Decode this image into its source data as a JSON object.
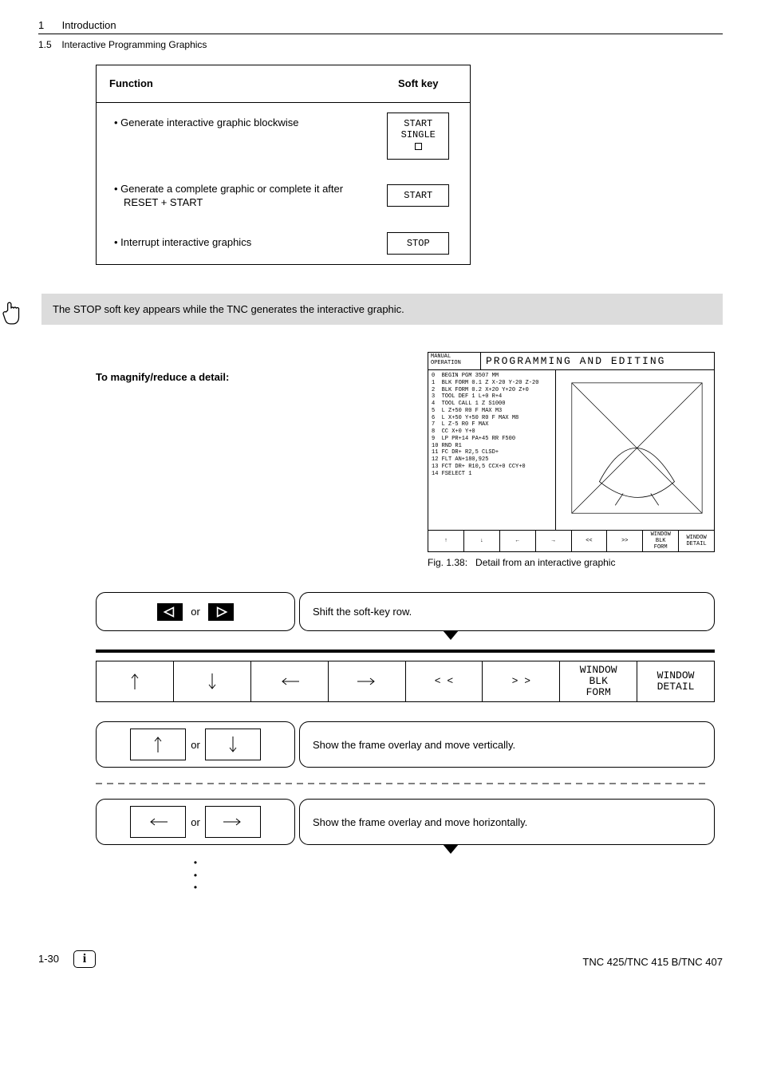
{
  "header": {
    "chapter_num": "1",
    "chapter_title": "Introduction",
    "section_num": "1.5",
    "section_title": "Interactive Programming Graphics"
  },
  "fn_table": {
    "head_l": "Function",
    "head_r": "Soft key",
    "rows": [
      {
        "text": "Generate interactive graphic blockwise",
        "key_l1": "START",
        "key_l2": "SINGLE",
        "has_square": true
      },
      {
        "text": "Generate a complete graphic or complete it after RESET + START",
        "key_l1": "START",
        "key_l2": "",
        "has_square": false
      },
      {
        "text": "Interrupt interactive graphics",
        "key_l1": "STOP",
        "key_l2": "",
        "has_square": false
      }
    ]
  },
  "note": "The STOP soft key appears while the TNC generates the interactive graphic.",
  "subhead": "To magnify/reduce a detail:",
  "screen": {
    "mode_l1": "MANUAL",
    "mode_l2": "OPERATION",
    "title": "PROGRAMMING AND EDITING",
    "code": "0  BEGIN PGM 3507 MM\n1  BLK FORM 0.1 Z X-20 Y-20 Z-20\n2  BLK FORM 0.2 X+20 Y+20 Z+0\n3  TOOL DEF 1 L+0 R+4\n4  TOOL CALL 1 Z S1000\n5  L Z+50 R0 F MAX M3\n6  L X+50 Y+50 R0 F MAX M8\n7  L Z-5 R0 F MAX\n8  CC X+0 Y+0\n9  LP PR+14 PA+45 RR F500\n10 RND R1\n11 FC DR+ R2,5 CLSD+\n12 FLT AN+180,925\n13 FCT DR+ R10,5 CCX+0 CCY+0\n14 FSELECT 1",
    "softkeys": [
      "↑",
      "↓",
      "←",
      "→",
      "<<",
      ">>",
      "WINDOW\nBLK\nFORM",
      "WINDOW\nDETAIL"
    ]
  },
  "fig_caption_num": "Fig. 1.38:",
  "fig_caption_text": "Detail from an interactive graphic",
  "step1": {
    "or": "or",
    "text": "Shift the soft-key row."
  },
  "softkey_row": [
    "↑",
    "↓",
    "←",
    "→",
    "< <",
    "> >",
    "WINDOW\nBLK\nFORM",
    "WINDOW\nDETAIL"
  ],
  "step3a": {
    "or": "or",
    "text": "Show the frame overlay and move vertically."
  },
  "step3b": {
    "or": "or",
    "text": "Show the frame overlay and move horizontally."
  },
  "footer": {
    "page": "1-30",
    "boilerplate": "TNC 425/TNC 415 B/TNC 407"
  }
}
